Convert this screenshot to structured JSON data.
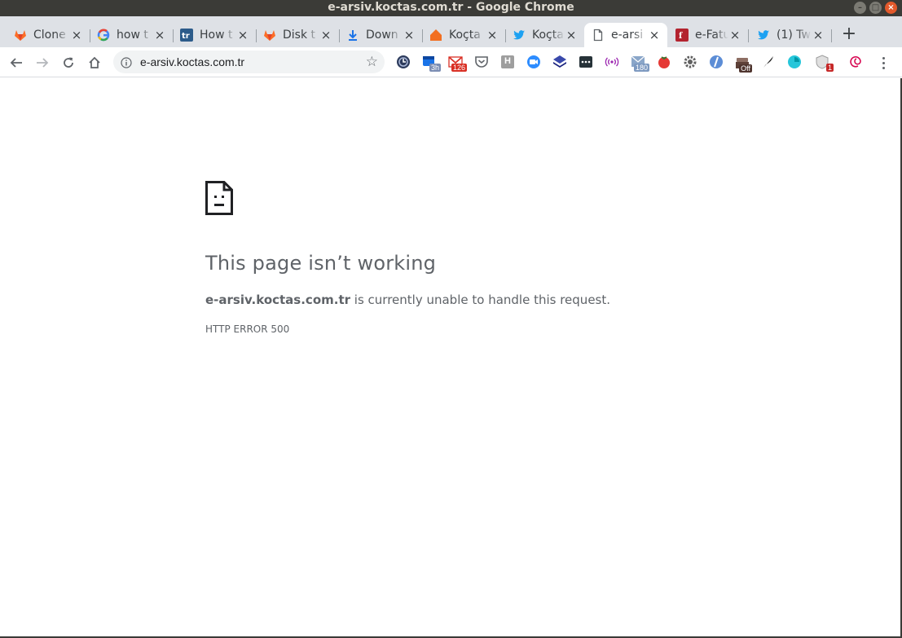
{
  "window": {
    "title": "e-arsiv.koctas.com.tr - Google Chrome"
  },
  "tabs": [
    {
      "label": "Clone",
      "icon": "gitlab-icon"
    },
    {
      "label": "how t",
      "icon": "google-icon"
    },
    {
      "label": "How t",
      "icon": "tr-icon"
    },
    {
      "label": "Disk t",
      "icon": "gitlab-icon"
    },
    {
      "label": "Down",
      "icon": "download-icon"
    },
    {
      "label": "Koçta",
      "icon": "koctas-home-icon"
    },
    {
      "label": "Koçta",
      "icon": "twitter-icon"
    },
    {
      "label": "e-arsi",
      "icon": "page-icon",
      "active": true
    },
    {
      "label": "e-Fatu",
      "icon": "efatura-icon"
    },
    {
      "label": "(1) Tw",
      "icon": "twitter-icon"
    }
  ],
  "tab_close": "×",
  "new_tab": "+",
  "omnibox": {
    "url": "e-arsiv.koctas.com.tr"
  },
  "extensions": {
    "badge_3h": "3h",
    "badge_126": "126",
    "badge_h": "H",
    "badge_180": "180",
    "badge_off": "Off",
    "badge_1": "1"
  },
  "error": {
    "title": "This page isn’t working",
    "host": "e-arsiv.koctas.com.tr",
    "message": " is currently unable to handle this request.",
    "code": "HTTP ERROR 500"
  },
  "colors": {
    "accent": "#1a73e8",
    "text": "#5f6368",
    "tabstrip": "#dee1e6",
    "titlebar": "#3b3b37"
  }
}
